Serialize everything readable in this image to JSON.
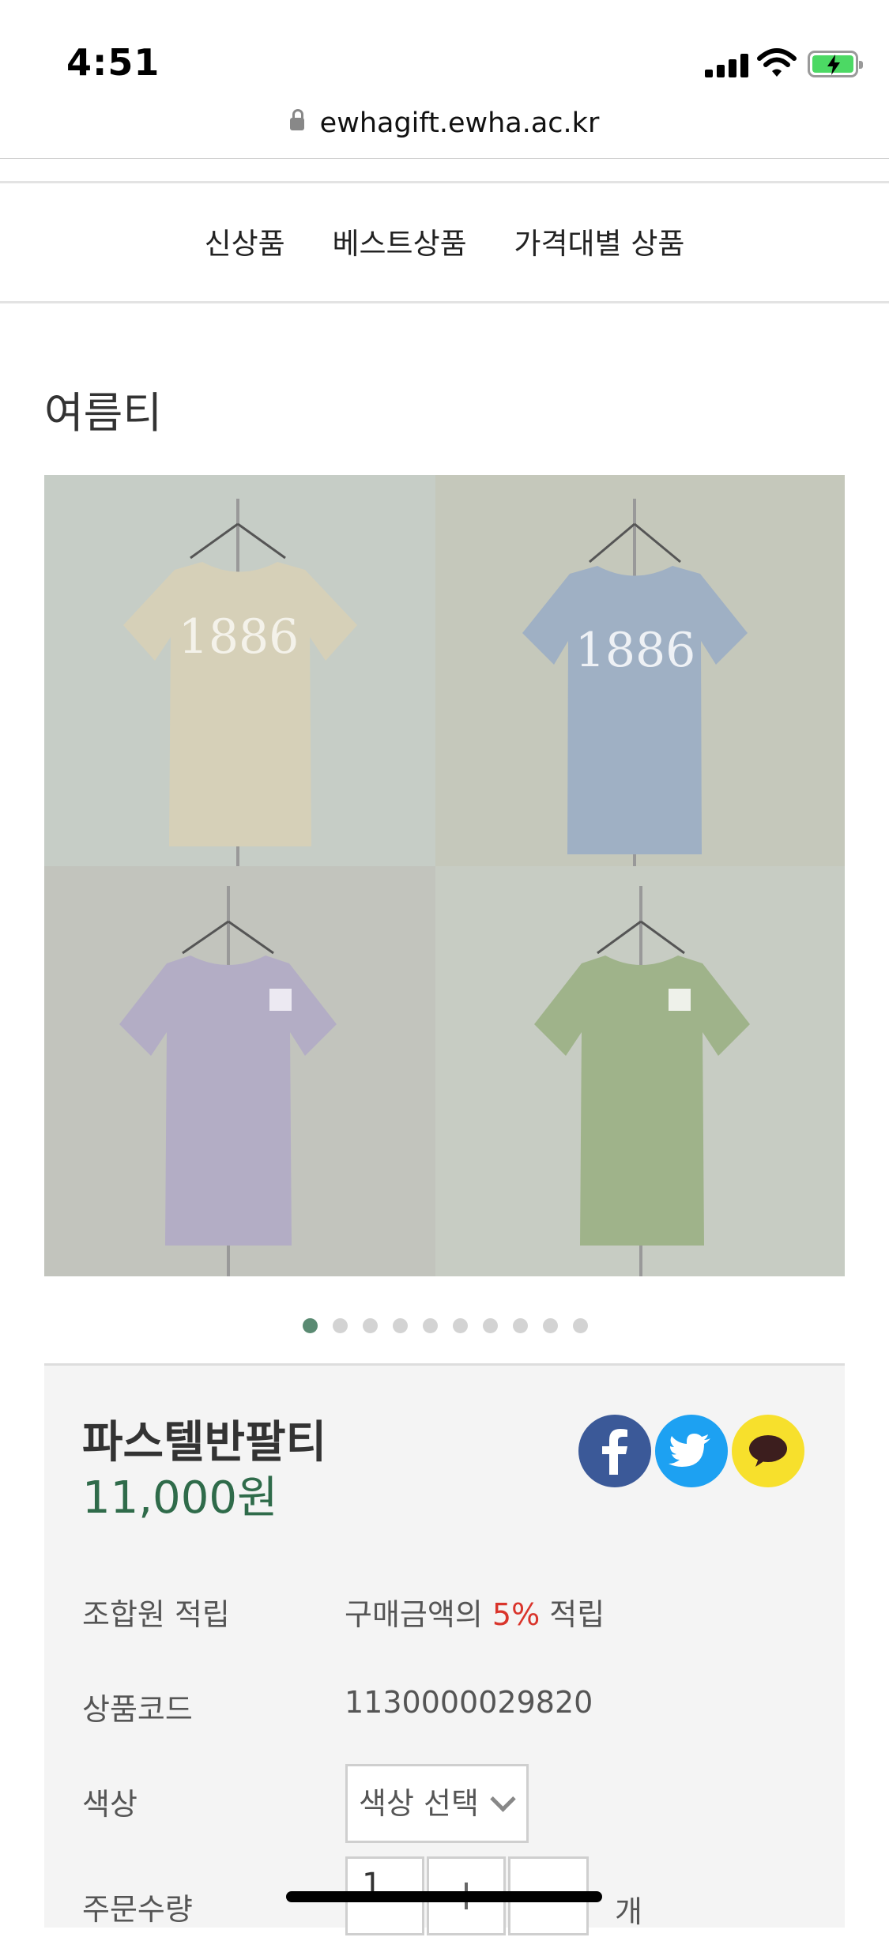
{
  "status_bar": {
    "time": "4:51"
  },
  "browser": {
    "url": "ewhagift.ewha.ac.kr"
  },
  "nav": {
    "items": [
      "신상품",
      "베스트상품",
      "가격대별 상품"
    ]
  },
  "category": {
    "title": "여름티"
  },
  "product_image": {
    "shirts": [
      {
        "color": "#d6d0b8",
        "print": "1886"
      },
      {
        "color": "#9fb0c4",
        "print": "1886"
      },
      {
        "color": "#b3adc5",
        "print": ""
      },
      {
        "color": "#9fb38a",
        "print": ""
      }
    ]
  },
  "carousel": {
    "total": 10,
    "active": 1
  },
  "product": {
    "name": "파스텔반팔티",
    "price": "11,000원",
    "share": [
      "facebook-icon",
      "twitter-icon",
      "kakaotalk-icon"
    ],
    "points_label": "조합원 적립",
    "points_prefix": "구매금액의 ",
    "points_rate": "5%",
    "points_suffix": " 적립",
    "code_label": "상품코드",
    "code_value": "1130000029820",
    "color_label": "색상",
    "color_select": "색상 선택",
    "quantity_label": "주문수량",
    "quantity_value": "1",
    "quantity_unit": "개"
  },
  "colors": {
    "price_green": "#2f6b4a",
    "accent_red": "#d9342b",
    "active_dot": "#5a8a72"
  }
}
